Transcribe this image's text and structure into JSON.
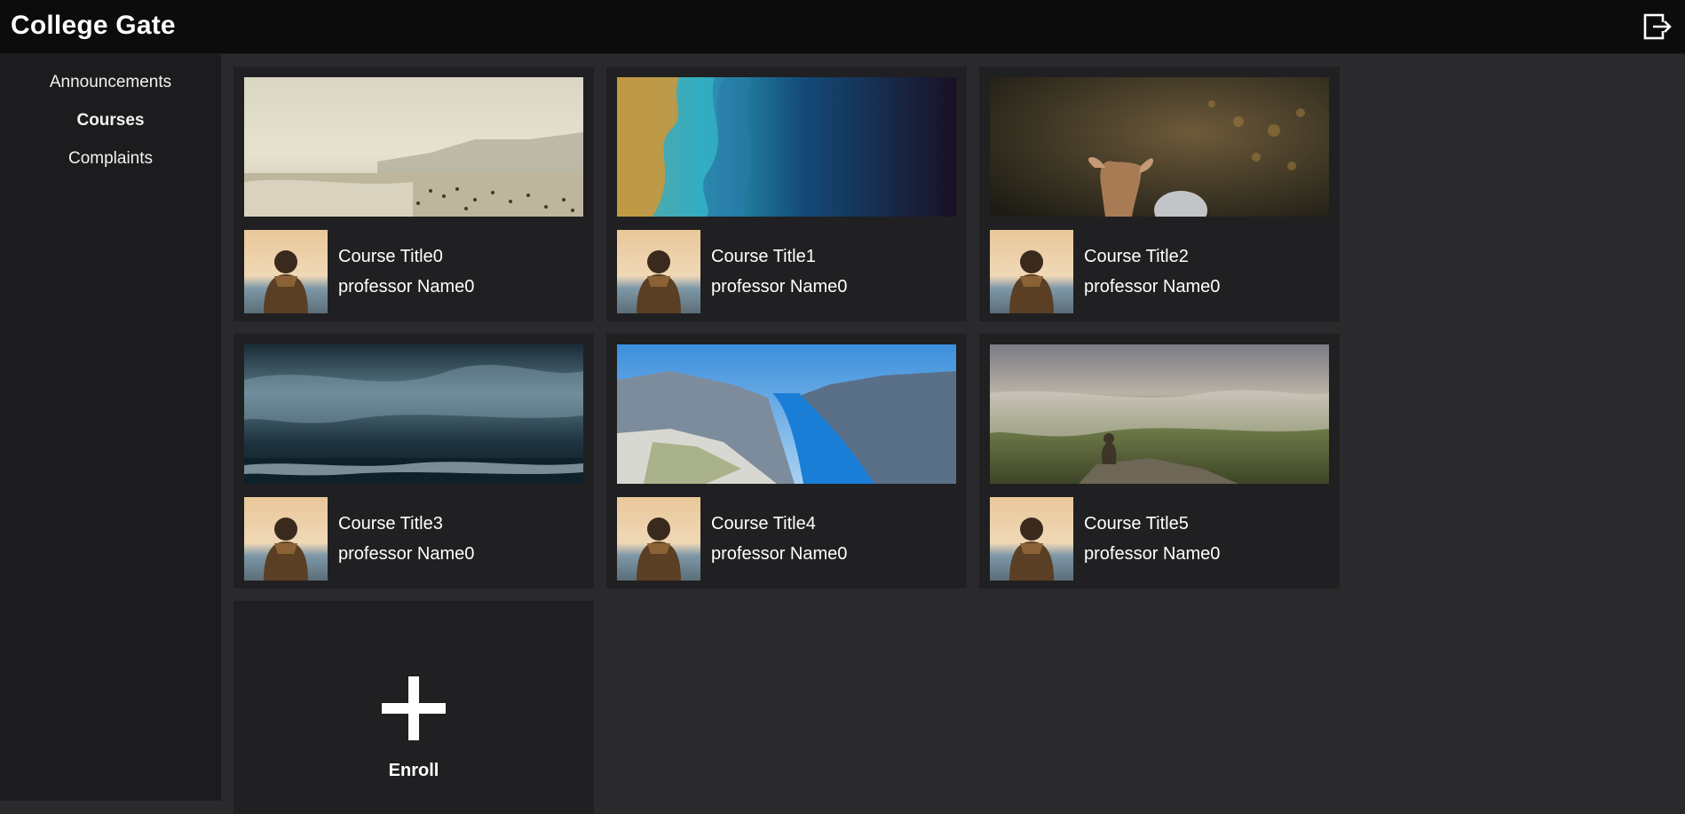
{
  "app": {
    "title": "College Gate",
    "logout_icon": "logout-icon"
  },
  "sidebar": {
    "items": [
      {
        "label": "Announcements",
        "active": false
      },
      {
        "label": "Courses",
        "active": true
      },
      {
        "label": "Complaints",
        "active": false
      }
    ]
  },
  "courses": [
    {
      "title": "Course Title0",
      "professor": "professor Name0",
      "banner": "beach-photo"
    },
    {
      "title": "Course Title1",
      "professor": "professor Name0",
      "banner": "satellite-coast-photo"
    },
    {
      "title": "Course Title2",
      "professor": "professor Name0",
      "banner": "deer-photo"
    },
    {
      "title": "Course Title3",
      "professor": "professor Name0",
      "banner": "stormy-sea-photo"
    },
    {
      "title": "Course Title4",
      "professor": "professor Name0",
      "banner": "fjord-photo"
    },
    {
      "title": "Course Title5",
      "professor": "professor Name0",
      "banner": "misty-mountain-photo"
    }
  ],
  "enroll": {
    "label": "Enroll",
    "icon": "plus-icon"
  },
  "colors": {
    "topbar": "#0c0c0c",
    "sidebar": "#1c1c1f",
    "background": "#2a2a2d",
    "card": "#202022",
    "text": "#ffffff"
  }
}
